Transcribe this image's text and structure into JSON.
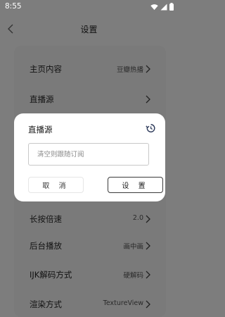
{
  "status_bar": {
    "time": "8:55"
  },
  "header": {
    "title": "设置"
  },
  "settings": {
    "rows": [
      {
        "label": "主页内容",
        "value": "豆瓣热播"
      },
      {
        "label": "直播源",
        "value": ""
      },
      {
        "label": "",
        "value": ""
      },
      {
        "label": "",
        "value": ""
      },
      {
        "label": "长按倍速",
        "value": "2.0"
      },
      {
        "label": "后台播放",
        "value": "画中画"
      },
      {
        "label": "IJK解码方式",
        "value": "硬解码"
      },
      {
        "label": "渲染方式",
        "value": "TextureView"
      }
    ]
  },
  "dialog": {
    "title": "直播源",
    "input_placeholder": "清空则跟随订阅",
    "input_value": "",
    "cancel_label": "取 消",
    "confirm_label": "设 置"
  },
  "colors": {
    "background": "#7d7d7d",
    "card": "#7a7a7a",
    "dialog": "#ffffff",
    "accent": "#1f3a7a"
  },
  "icons": [
    "wifi-icon",
    "signal-icon",
    "battery-icon",
    "back-arrow-icon",
    "history-icon",
    "chevron-right-icon"
  ]
}
